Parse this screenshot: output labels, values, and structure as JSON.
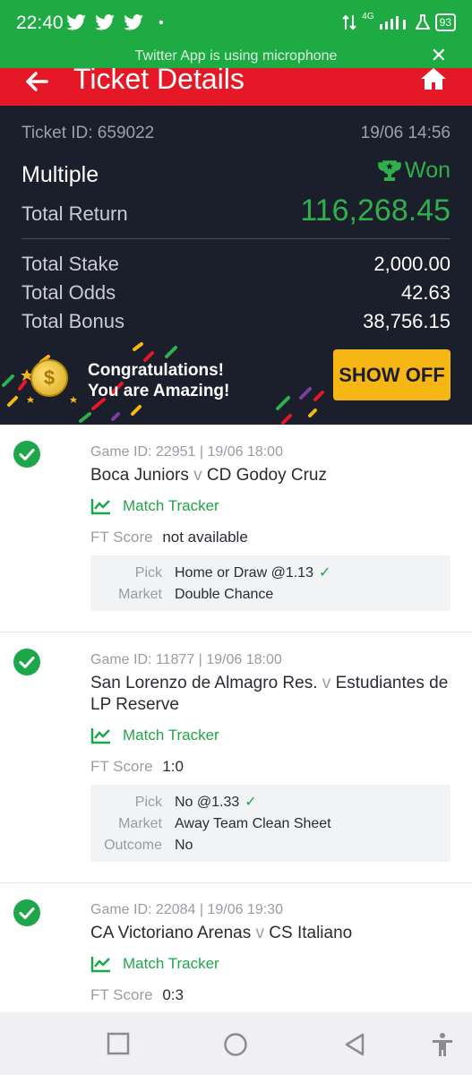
{
  "status_bar": {
    "time": "22:40",
    "network": "4G",
    "battery": "93"
  },
  "mic_banner": {
    "text": "Twitter App is using microphone"
  },
  "header": {
    "title": "Ticket Details"
  },
  "ticket": {
    "id_label": "Ticket ID: 659022",
    "datetime": "19/06 14:56",
    "type": "Multiple",
    "status": "Won",
    "total_return_label": "Total Return",
    "total_return": "116,268.45",
    "total_stake_label": "Total Stake",
    "total_stake": "2,000.00",
    "total_odds_label": "Total Odds",
    "total_odds": "42.63",
    "total_bonus_label": "Total Bonus",
    "total_bonus": "38,756.15"
  },
  "congrats": {
    "line1": "Congratulations!",
    "line2": "You are Amazing!",
    "coin_symbol": "$",
    "show_off_label": "SHOW OFF"
  },
  "bets": [
    {
      "meta": "Game ID: 22951 | 19/06 18:00",
      "home": "Boca  Juniors",
      "away": "CD Godoy Cruz",
      "tracker_label": "Match Tracker",
      "ft_label": "FT Score",
      "ft_value": "not available",
      "pick_label": "Pick",
      "pick_value": "Home or Draw @1.13",
      "market_label": "Market",
      "market_value": "Double Chance"
    },
    {
      "meta": "Game ID: 11877 | 19/06 18:00",
      "home": "San Lorenzo de Almagro Res.",
      "away": "Estudiantes de LP Reserve",
      "tracker_label": "Match Tracker",
      "ft_label": "FT Score",
      "ft_value": "1:0",
      "pick_label": "Pick",
      "pick_value": "No @1.33",
      "market_label": "Market",
      "market_value": "Away Team Clean Sheet",
      "outcome_label": "Outcome",
      "outcome_value": "No"
    },
    {
      "meta": "Game ID: 22084 | 19/06 19:30",
      "home": "CA Victoriano Arenas",
      "away": "CS Italiano",
      "tracker_label": "Match Tracker",
      "ft_label": "FT Score",
      "ft_value": "0:3"
    }
  ],
  "versus": "v",
  "colors": {
    "status_bar": "#1eab43",
    "header": "#e41827",
    "summary_bg": "#1b1e2b",
    "won_green": "#2fb04b",
    "show_off": "#f6b614"
  }
}
